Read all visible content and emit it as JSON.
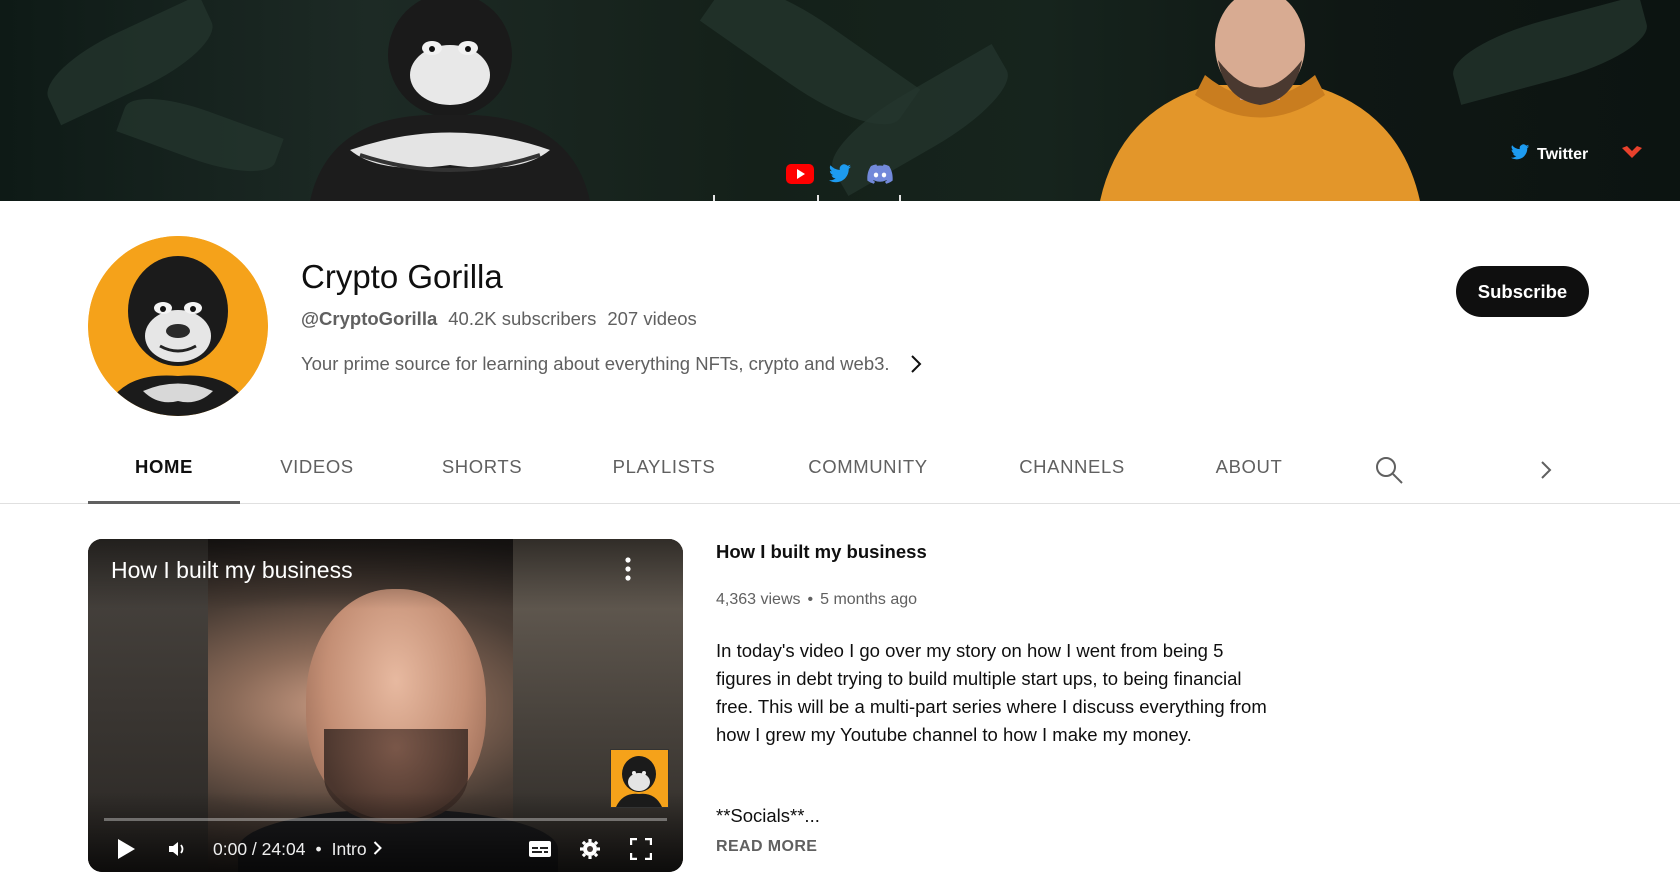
{
  "banner": {
    "social_link_label": "Twitter",
    "icons": [
      "youtube-icon",
      "twitter-icon",
      "discord-icon"
    ]
  },
  "channel": {
    "name": "Crypto Gorilla",
    "handle": "@CryptoGorilla",
    "subscribers": "40.2K subscribers",
    "videos": "207 videos",
    "description": "Your prime source for learning about everything NFTs, crypto and web3.",
    "subscribe_label": "Subscribe"
  },
  "tabs": [
    {
      "label": "HOME",
      "active": true
    },
    {
      "label": "VIDEOS",
      "active": false
    },
    {
      "label": "SHORTS",
      "active": false
    },
    {
      "label": "PLAYLISTS",
      "active": false
    },
    {
      "label": "COMMUNITY",
      "active": false
    },
    {
      "label": "CHANNELS",
      "active": false
    },
    {
      "label": "ABOUT",
      "active": false
    }
  ],
  "featured_video": {
    "overlay_title": "How I built my business",
    "time": "0:00 / 24:04",
    "chapter": "Intro",
    "title": "How I built my business",
    "views": "4,363 views",
    "age": "5 months ago",
    "description": "In today's video I go over my story on how I went from being 5 figures in debt trying to build multiple start ups, to being financial free. This will be a multi-part series where I discuss everything from how I grew my Youtube channel to how I make my money.",
    "socials_line": "**Socials**...",
    "read_more": "READ MORE"
  },
  "colors": {
    "accent_orange": "#f5a21a",
    "subscribe_bg": "#0f0f0f",
    "secondary_text": "#606060",
    "youtube_red": "#ff0000",
    "twitter_blue": "#1d9bf0",
    "discord_blurple": "#7289da"
  }
}
